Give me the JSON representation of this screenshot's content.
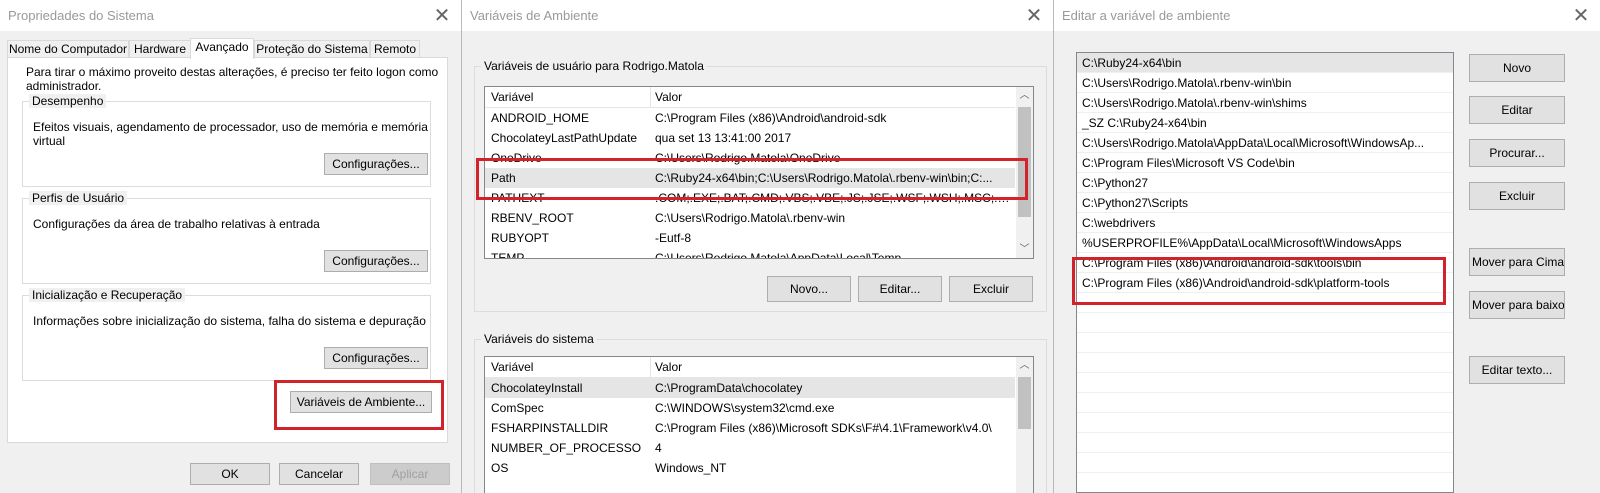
{
  "win1": {
    "title": "Propriedades do Sistema",
    "tabs": [
      "Nome do Computador",
      "Hardware",
      "Avançado",
      "Proteção do Sistema",
      "Remoto"
    ],
    "intro_line1": "Para tirar o máximo proveito destas alterações, é preciso ter feito logon como",
    "intro_line2": "administrador.",
    "desempenho": {
      "label": "Desempenho",
      "text_line1": "Efeitos visuais, agendamento de processador, uso de memória e memória",
      "text_line2": "virtual",
      "button": "Configurações..."
    },
    "perfis": {
      "label": "Perfis de Usuário",
      "text": "Configurações da área de trabalho relativas à entrada",
      "button": "Configurações..."
    },
    "inicializacao": {
      "label": "Inicialização e Recuperação",
      "text": "Informações sobre inicialização do sistema, falha do sistema e depuração",
      "button": "Configurações..."
    },
    "env_button": "Variáveis de Ambiente...",
    "ok": "OK",
    "cancel": "Cancelar",
    "apply": "Aplicar"
  },
  "win2": {
    "title": "Variáveis de Ambiente",
    "user_group_label": "Variáveis de usuário para Rodrigo.Matola",
    "columns": [
      "Variável",
      "Valor"
    ],
    "user_vars": [
      {
        "name": "ANDROID_HOME",
        "value": "C:\\Program Files (x86)\\Android\\android-sdk"
      },
      {
        "name": "ChocolateyLastPathUpdate",
        "value": "qua set 13 13:41:00 2017"
      },
      {
        "name": "OneDrive",
        "value": "C:\\Users\\Rodrigo.Matola\\OneDrive"
      },
      {
        "name": "Path",
        "value": "C:\\Ruby24-x64\\bin;C:\\Users\\Rodrigo.Matola\\.rbenv-win\\bin;C:..."
      },
      {
        "name": "PATHEXT",
        "value": ".COM;.EXE;.BAT;.CMD;.VBS;.VBE;.JS;.JSE;.WSF;.WSH;.MSC;.RB;.RB..."
      },
      {
        "name": "RBENV_ROOT",
        "value": "C:\\Users\\Rodrigo.Matola\\.rbenv-win"
      },
      {
        "name": "RUBYOPT",
        "value": "-Eutf-8"
      },
      {
        "name": "TEMP",
        "value": "C:\\Users\\Rodrigo.Matola\\AppData\\Local\\Temp"
      }
    ],
    "user_buttons": {
      "new": "Novo...",
      "edit": "Editar...",
      "delete": "Excluir"
    },
    "system_group_label": "Variáveis do sistema",
    "system_vars": [
      {
        "name": "ChocolateyInstall",
        "value": "C:\\ProgramData\\chocolatey"
      },
      {
        "name": "ComSpec",
        "value": "C:\\WINDOWS\\system32\\cmd.exe"
      },
      {
        "name": "FSHARPINSTALLDIR",
        "value": "C:\\Program Files (x86)\\Microsoft SDKs\\F#\\4.1\\Framework\\v4.0\\"
      },
      {
        "name": "NUMBER_OF_PROCESSORS",
        "value": "4"
      },
      {
        "name": "OS",
        "value": "Windows_NT"
      }
    ]
  },
  "win3": {
    "title": "Editar a variável de ambiente",
    "entries": [
      "C:\\Ruby24-x64\\bin",
      "C:\\Users\\Rodrigo.Matola\\.rbenv-win\\bin",
      "C:\\Users\\Rodrigo.Matola\\.rbenv-win\\shims",
      "_SZ    C:\\Ruby24-x64\\bin",
      "C:\\Users\\Rodrigo.Matola\\AppData\\Local\\Microsoft\\WindowsAp...",
      "C:\\Program Files\\Microsoft VS Code\\bin",
      "C:\\Python27",
      "C:\\Python27\\Scripts",
      "C:\\webdrivers",
      "%USERPROFILE%\\AppData\\Local\\Microsoft\\WindowsApps",
      "C:\\Program Files (x86)\\Android\\android-sdk\\tools\\bin",
      "C:\\Program Files (x86)\\Android\\android-sdk\\platform-tools"
    ],
    "buttons": {
      "new": "Novo",
      "edit": "Editar",
      "browse": "Procurar...",
      "delete": "Excluir",
      "move_up": "Mover para Cima",
      "move_down": "Mover para baixo",
      "edit_text": "Editar texto..."
    }
  },
  "colors": {
    "highlight": "#d2232a",
    "selection": "#e5e5e5",
    "button": "#e1e1e1"
  },
  "icons": {
    "close": "close-icon",
    "scroll_up": "chevron-up-icon",
    "scroll_down": "chevron-down-icon"
  }
}
